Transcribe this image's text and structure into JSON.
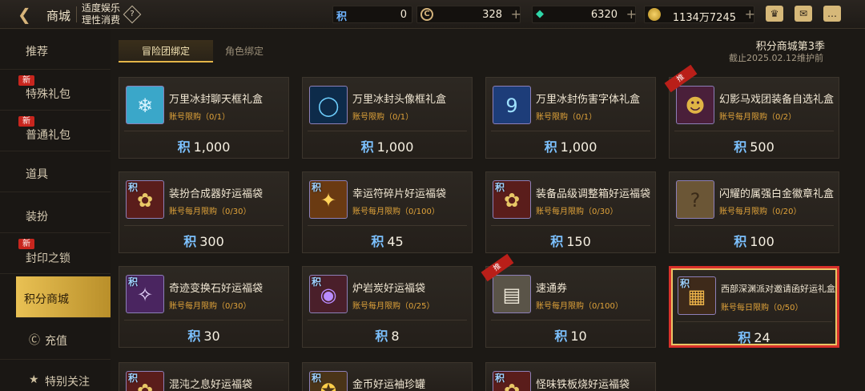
{
  "header": {
    "title": "商城",
    "notice_line1": "适度娱乐",
    "notice_line2": "理性消费",
    "help_icon": "question-diamond-icon"
  },
  "currencies": [
    {
      "name": "points",
      "icon": "积",
      "value": "0",
      "plus": ""
    },
    {
      "name": "ceras",
      "icon": "C",
      "value": "328",
      "plus": "+"
    },
    {
      "name": "gems",
      "icon": "◆",
      "value": "6320",
      "plus": "+"
    },
    {
      "name": "gold",
      "icon": "",
      "value": "1134万7245",
      "plus": "+"
    }
  ],
  "top_icons": [
    "crown-icon",
    "mail-icon",
    "chat-icon"
  ],
  "sidebar": {
    "items": [
      {
        "label": "推荐",
        "badge": ""
      },
      {
        "label": "特殊礼包",
        "badge": "新"
      },
      {
        "label": "普通礼包",
        "badge": "新"
      },
      {
        "label": "道具",
        "badge": ""
      },
      {
        "label": "装扮",
        "badge": ""
      },
      {
        "label": "封印之锁",
        "badge": "新"
      },
      {
        "label": "积分商城",
        "badge": ""
      },
      {
        "label": "充值",
        "badge": ""
      },
      {
        "label": "特别关注",
        "badge": ""
      }
    ]
  },
  "tabs": {
    "active": "冒险团绑定",
    "inactive": "角色绑定"
  },
  "season": {
    "title": "积分商城第3季",
    "deadline": "截止2025.02.12维护前"
  },
  "price_icon": "积",
  "cards": [
    {
      "name": "万里冰封聊天框礼盒",
      "limit": "账号限购（0/1）",
      "price": "1,000",
      "icon": "ice-chat-frame-icon",
      "ribbon": ""
    },
    {
      "name": "万里冰封头像框礼盒",
      "limit": "账号限购（0/1）",
      "price": "1,000",
      "icon": "ice-avatar-frame-icon",
      "ribbon": ""
    },
    {
      "name": "万里冰封伤害字体礼盒",
      "limit": "账号限购（0/1）",
      "price": "1,000",
      "icon": "ice-damage-font-icon",
      "ribbon": ""
    },
    {
      "name": "幻影马戏团装备自选礼盒",
      "limit": "账号每月限购（0/2）",
      "price": "500",
      "icon": "circus-jester-icon",
      "ribbon": "推"
    },
    {
      "name": "装扮合成器好运福袋",
      "limit": "账号每月限购（0/30）",
      "price": "300",
      "icon": "lucky-bag-icon",
      "ribbon": ""
    },
    {
      "name": "幸运符碎片好运福袋",
      "limit": "账号每月限购（0/100）",
      "price": "45",
      "icon": "gold-bag-icon",
      "ribbon": ""
    },
    {
      "name": "装备品级调整箱好运福袋",
      "limit": "账号每月限购（0/30）",
      "price": "150",
      "icon": "lucky-bag-icon",
      "ribbon": ""
    },
    {
      "name": "闪耀的属强白金徽章礼盒",
      "limit": "账号每月限购（0/20）",
      "price": "100",
      "icon": "mystery-box-icon",
      "ribbon": ""
    },
    {
      "name": "奇迹变换石好运福袋",
      "limit": "账号每月限购（0/30）",
      "price": "30",
      "icon": "crystal-bag-icon",
      "ribbon": ""
    },
    {
      "name": "炉岩炭好运福袋",
      "limit": "账号每月限购（0/25）",
      "price": "8",
      "icon": "ore-bag-icon",
      "ribbon": ""
    },
    {
      "name": "速通券",
      "limit": "账号每月限购（0/100）",
      "price": "10",
      "icon": "ticket-icon",
      "ribbon": "推"
    },
    {
      "name": "西部深渊派对邀请函好运礼盒",
      "limit": "账号每日限购（0/50）",
      "price": "24",
      "icon": "treasure-chest-icon",
      "ribbon": ""
    },
    {
      "name": "混沌之息好运福袋",
      "limit": "",
      "price": "",
      "icon": "lucky-bag-icon",
      "ribbon": ""
    },
    {
      "name": "金币好运袖珍罐",
      "limit": "",
      "price": "",
      "icon": "gold-jar-icon",
      "ribbon": ""
    },
    {
      "name": "怪味铁板烧好运福袋",
      "limit": "",
      "price": "",
      "icon": "lucky-bag-icon",
      "ribbon": ""
    }
  ]
}
